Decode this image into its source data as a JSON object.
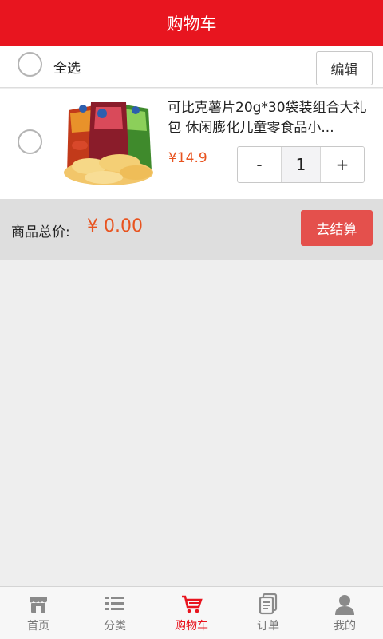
{
  "header": {
    "title": "购物车"
  },
  "select_all": {
    "label": "全选",
    "checked": false,
    "edit_label": "编辑"
  },
  "cart_items": [
    {
      "title": "可比克薯片20g*30袋装组合大礼包 休闲膨化儿童零食品小...",
      "price": "¥14.9",
      "quantity": "1",
      "minus_label": "-",
      "plus_label": "+",
      "checked": false,
      "image_icon": "potato-chips-product-image"
    }
  ],
  "total": {
    "label": "商品总价:",
    "value": "¥ 0.00",
    "checkout_label": "去结算"
  },
  "tabbar": {
    "items": [
      {
        "label": "首页",
        "icon": "shop-icon",
        "active": false
      },
      {
        "label": "分类",
        "icon": "list-icon",
        "active": false
      },
      {
        "label": "购物车",
        "icon": "cart-icon",
        "active": true
      },
      {
        "label": "订单",
        "icon": "orders-icon",
        "active": false
      },
      {
        "label": "我的",
        "icon": "user-icon",
        "active": false
      }
    ]
  },
  "colors": {
    "brand": "#e8151f",
    "price": "#e8531f",
    "checkout": "#e4504c"
  }
}
